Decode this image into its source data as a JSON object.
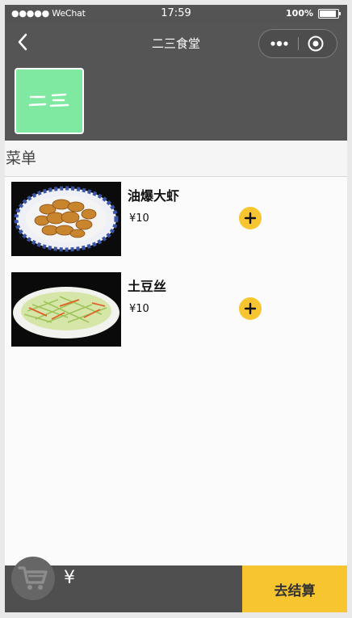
{
  "status_bar": {
    "carrier": "●●●●● WeChat",
    "time": "17:59",
    "battery": "100%"
  },
  "nav": {
    "title": "二三食堂"
  },
  "store": {
    "logo_text": "二三",
    "logo_color": "#7fe8a1"
  },
  "menu": {
    "section_title": "菜单",
    "items": [
      {
        "name": "油爆大虾",
        "price": "¥10"
      },
      {
        "name": "土豆丝",
        "price": "¥10"
      }
    ]
  },
  "cart": {
    "total_label": "¥",
    "checkout_label": "去结算"
  },
  "colors": {
    "bar": "#555555",
    "accent": "#f7c530"
  }
}
